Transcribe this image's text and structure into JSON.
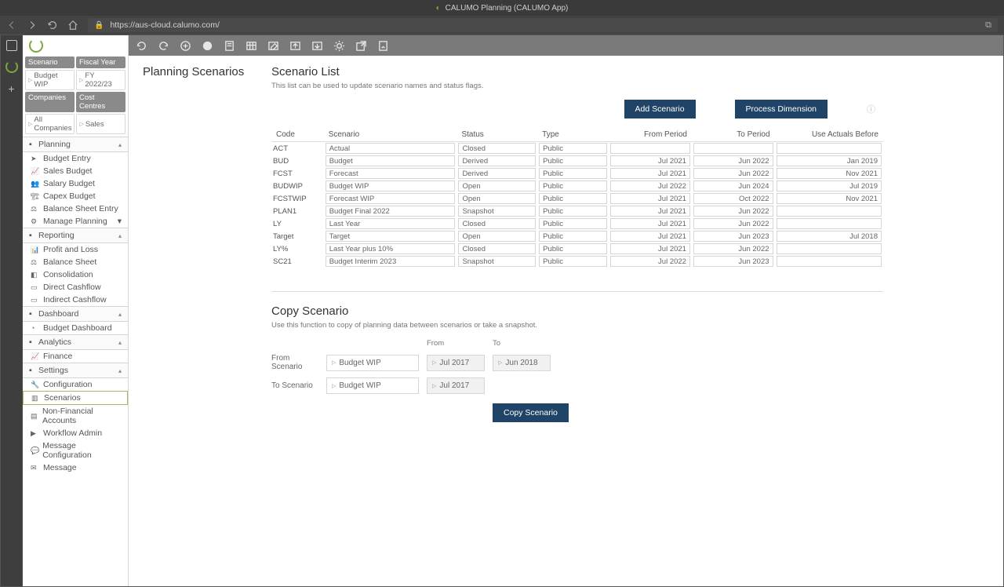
{
  "title": "CALUMO Planning (CALUMO App)",
  "url": "https://aus-cloud.calumo.com/",
  "filters": {
    "scenario_label": "Scenario",
    "fiscal_label": "Fiscal Year",
    "scenario_val": "Budget WIP",
    "fiscal_val": "FY 2022/23",
    "companies_label": "Companies",
    "cost_label": "Cost Centres",
    "companies_val": "All Companies",
    "cost_val": "Sales"
  },
  "nav": {
    "planning": "Planning",
    "planning_items": [
      "Budget Entry",
      "Sales Budget",
      "Salary Budget",
      "Capex Budget",
      "Balance Sheet Entry",
      "Manage Planning"
    ],
    "reporting": "Reporting",
    "reporting_items": [
      "Profit and Loss",
      "Balance Sheet",
      "Consolidation",
      "Direct Cashflow",
      "Indirect Cashflow"
    ],
    "dashboard": "Dashboard",
    "dashboard_items": [
      "Budget Dashboard"
    ],
    "analytics": "Analytics",
    "analytics_items": [
      "Finance"
    ],
    "settings": "Settings",
    "settings_items": [
      "Configuration",
      "Scenarios",
      "Non-Financial Accounts",
      "Workflow Admin",
      "Message Configuration",
      "Message"
    ]
  },
  "page": {
    "breadcrumb": "Planning Scenarios",
    "list_title": "Scenario List",
    "list_sub": "This list can be used to update scenario names and status flags.",
    "add_btn": "Add Scenario",
    "process_btn": "Process Dimension",
    "headers": [
      "Code",
      "Scenario",
      "Status",
      "Type",
      "From Period",
      "To Period",
      "Use Actuals Before"
    ],
    "rows": [
      {
        "code": "ACT",
        "scenario": "Actual",
        "status": "Closed",
        "type": "Public",
        "from": "",
        "to": "",
        "use": ""
      },
      {
        "code": "BUD",
        "scenario": "Budget",
        "status": "Derived",
        "type": "Public",
        "from": "Jul 2021",
        "to": "Jun 2022",
        "use": "Jan 2019"
      },
      {
        "code": "FCST",
        "scenario": "Forecast",
        "status": "Derived",
        "type": "Public",
        "from": "Jul 2021",
        "to": "Jun 2022",
        "use": "Nov 2021"
      },
      {
        "code": "BUDWIP",
        "scenario": "Budget WIP",
        "status": "Open",
        "type": "Public",
        "from": "Jul 2022",
        "to": "Jun 2024",
        "use": "Jul 2019"
      },
      {
        "code": "FCSTWIP",
        "scenario": "Forecast WIP",
        "status": "Open",
        "type": "Public",
        "from": "Jul 2021",
        "to": "Oct 2022",
        "use": "Nov 2021"
      },
      {
        "code": "PLAN1",
        "scenario": "Budget Final 2022",
        "status": "Snapshot",
        "type": "Public",
        "from": "Jul 2021",
        "to": "Jun 2022",
        "use": ""
      },
      {
        "code": "LY",
        "scenario": "Last Year",
        "status": "Closed",
        "type": "Public",
        "from": "Jul 2021",
        "to": "Jun 2022",
        "use": ""
      },
      {
        "code": "Target",
        "scenario": "Target",
        "status": "Open",
        "type": "Public",
        "from": "Jul 2021",
        "to": "Jun 2023",
        "use": "Jul 2018"
      },
      {
        "code": "LY%",
        "scenario": "Last Year plus 10%",
        "status": "Closed",
        "type": "Public",
        "from": "Jul 2021",
        "to": "Jun 2022",
        "use": ""
      },
      {
        "code": "SC21",
        "scenario": "Budget Interim 2023",
        "status": "Snapshot",
        "type": "Public",
        "from": "Jul 2022",
        "to": "Jun 2023",
        "use": ""
      }
    ],
    "copy_title": "Copy Scenario",
    "copy_sub": "Use this function to copy of planning data between scenarios or take a snapshot.",
    "from_scen_lbl": "From Scenario",
    "to_scen_lbl": "To Scenario",
    "from_lbl": "From",
    "to_lbl": "To",
    "from_scen": "Budget WIP",
    "from_p": "Jul 2017",
    "to_p": "Jun 2018",
    "to_scen": "Budget WIP",
    "to_from_p": "Jul 2017",
    "copy_btn": "Copy Scenario"
  }
}
